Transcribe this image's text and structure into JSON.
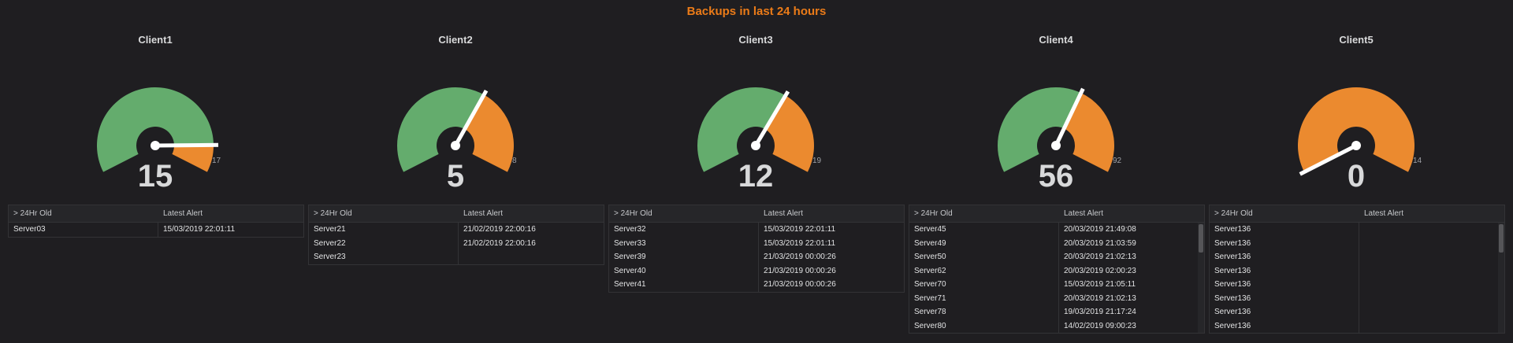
{
  "title": "Backups in last 24 hours",
  "colors": {
    "green": "#64ac6d",
    "orange": "#eb8a2f",
    "needle": "#ffffff",
    "title": "#eb7b18"
  },
  "table_headers": {
    "col1": "> 24Hr Old",
    "col2": "Latest Alert"
  },
  "clients": [
    {
      "name": "Client1",
      "value": "15",
      "max": "17",
      "rows": [
        {
          "server": "Server03",
          "alert": "15/03/2019 22:01:11"
        }
      ]
    },
    {
      "name": "Client2",
      "value": "5",
      "max": "8",
      "rows": [
        {
          "server": "Server21",
          "alert": "21/02/2019 22:00:16"
        },
        {
          "server": "Server22",
          "alert": "21/02/2019 22:00:16"
        },
        {
          "server": "Server23",
          "alert": ""
        }
      ]
    },
    {
      "name": "Client3",
      "value": "12",
      "max": "19",
      "rows": [
        {
          "server": "Server32",
          "alert": "15/03/2019 22:01:11"
        },
        {
          "server": "Server33",
          "alert": "15/03/2019 22:01:11"
        },
        {
          "server": "Server39",
          "alert": "21/03/2019 00:00:26"
        },
        {
          "server": "Server40",
          "alert": "21/03/2019 00:00:26"
        },
        {
          "server": "Server41",
          "alert": "21/03/2019 00:00:26"
        }
      ]
    },
    {
      "name": "Client4",
      "value": "56",
      "max": "92",
      "rows": [
        {
          "server": "Server45",
          "alert": "20/03/2019 21:49:08"
        },
        {
          "server": "Server49",
          "alert": "20/03/2019 21:03:59"
        },
        {
          "server": "Server50",
          "alert": "20/03/2019 21:02:13"
        },
        {
          "server": "Server62",
          "alert": "20/03/2019 02:00:23"
        },
        {
          "server": "Server70",
          "alert": "15/03/2019 21:05:11"
        },
        {
          "server": "Server71",
          "alert": "20/03/2019 21:02:13"
        },
        {
          "server": "Server78",
          "alert": "19/03/2019 21:17:24"
        },
        {
          "server": "Server80",
          "alert": "14/02/2019 09:00:23"
        }
      ]
    },
    {
      "name": "Client5",
      "value": "0",
      "max": "14",
      "rows": [
        {
          "server": "Server136",
          "alert": ""
        },
        {
          "server": "Server136",
          "alert": ""
        },
        {
          "server": "Server136",
          "alert": ""
        },
        {
          "server": "Server136",
          "alert": ""
        },
        {
          "server": "Server136",
          "alert": ""
        },
        {
          "server": "Server136",
          "alert": ""
        },
        {
          "server": "Server136",
          "alert": ""
        },
        {
          "server": "Server136",
          "alert": ""
        }
      ]
    }
  ]
}
